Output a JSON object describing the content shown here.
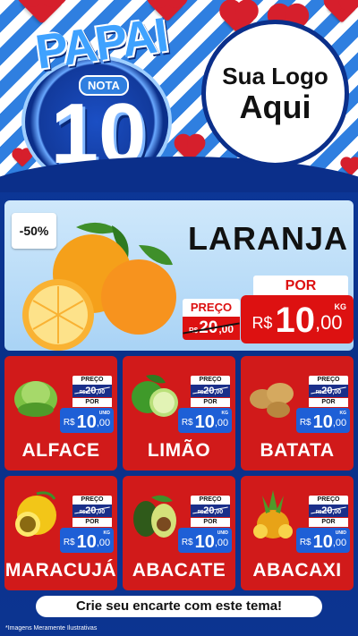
{
  "header": {
    "badge_word": "PAPAI",
    "badge_nota": "NOTA",
    "badge_number": "10",
    "logo_line1": "Sua Logo",
    "logo_line2": "Aqui"
  },
  "featured": {
    "discount": "-50%",
    "name": "LARANJA",
    "preco_label": "PREÇO",
    "old_currency": "R$",
    "old_int": "20",
    "old_dec": ",00",
    "por_label": "POR",
    "new_currency": "R$",
    "new_int": "10",
    "new_dec": ",00",
    "unit": "KG"
  },
  "products": [
    {
      "name": "ALFACE",
      "preco_label": "PREÇO",
      "old_currency": "R$",
      "old_int": "20",
      "old_dec": ",00",
      "por_label": "POR",
      "new_currency": "R$",
      "new_int": "10",
      "new_dec": ",00",
      "unit": "UNID",
      "icon": "lettuce-icon"
    },
    {
      "name": "LIMÃO",
      "preco_label": "PREÇO",
      "old_currency": "R$",
      "old_int": "20",
      "old_dec": ",00",
      "por_label": "POR",
      "new_currency": "R$",
      "new_int": "10",
      "new_dec": ",00",
      "unit": "KG",
      "icon": "lime-icon"
    },
    {
      "name": "BATATA",
      "preco_label": "PREÇO",
      "old_currency": "R$",
      "old_int": "20",
      "old_dec": ",00",
      "por_label": "POR",
      "new_currency": "R$",
      "new_int": "10",
      "new_dec": ",00",
      "unit": "KG",
      "icon": "potato-icon"
    },
    {
      "name": "MARACUJÁ",
      "preco_label": "PREÇO",
      "old_currency": "R$",
      "old_int": "20",
      "old_dec": ",00",
      "por_label": "POR",
      "new_currency": "R$",
      "new_int": "10",
      "new_dec": ",00",
      "unit": "KG",
      "icon": "passion-fruit-icon"
    },
    {
      "name": "ABACATE",
      "preco_label": "PREÇO",
      "old_currency": "R$",
      "old_int": "20",
      "old_dec": ",00",
      "por_label": "POR",
      "new_currency": "R$",
      "new_int": "10",
      "new_dec": ",00",
      "unit": "UNID",
      "icon": "avocado-icon"
    },
    {
      "name": "ABACAXI",
      "preco_label": "PREÇO",
      "old_currency": "R$",
      "old_int": "20",
      "old_dec": ",00",
      "por_label": "POR",
      "new_currency": "R$",
      "new_int": "10",
      "new_dec": ",00",
      "unit": "UNID",
      "icon": "pineapple-icon"
    }
  ],
  "footer": {
    "cta": "Crie seu encarte com este tema!",
    "note": "*Imagens Meramente Ilustrativas"
  },
  "colors": {
    "card_red": "#d11a1a",
    "navy": "#0b2f8a",
    "price_blue": "#1e5fd6"
  }
}
